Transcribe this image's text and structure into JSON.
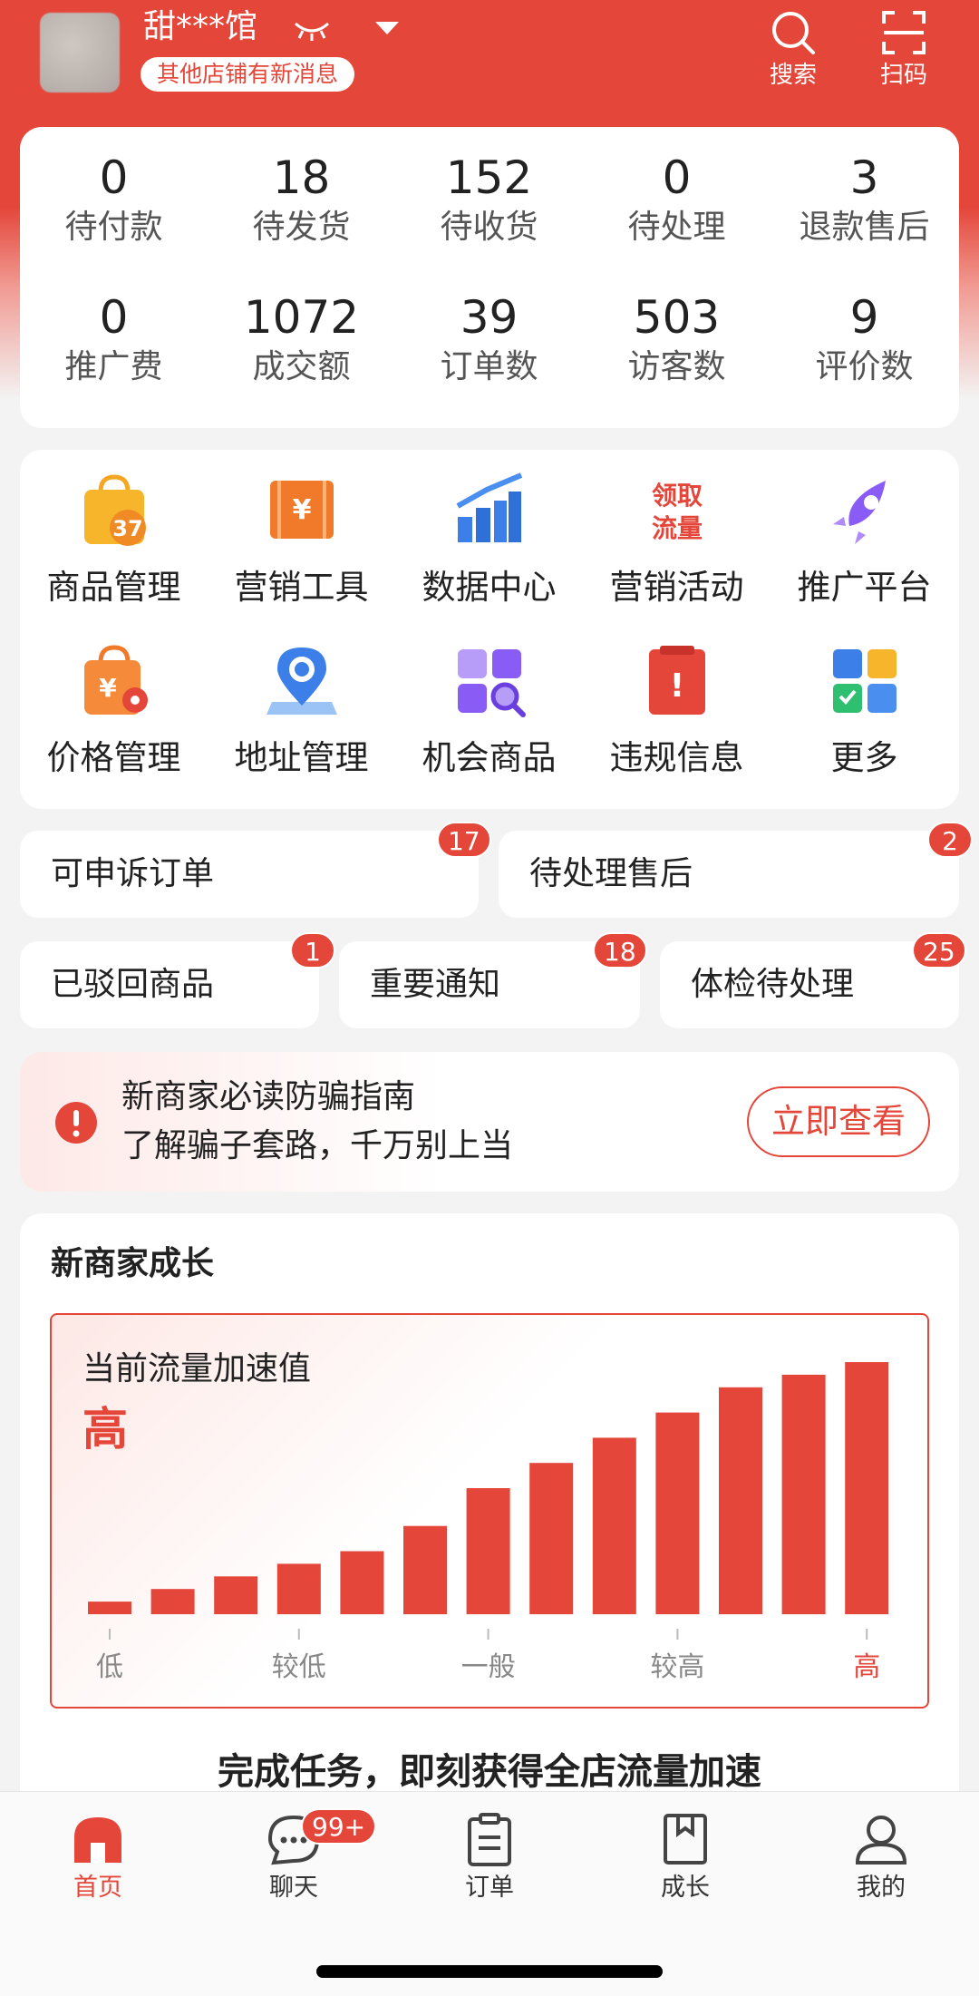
{
  "header": {
    "shop_name": "甜***馆",
    "shop_badge": "其他店铺有新消息",
    "search_label": "搜索",
    "scan_label": "扫码"
  },
  "stats": {
    "row1": [
      {
        "value": "0",
        "label": "待付款"
      },
      {
        "value": "18",
        "label": "待发货"
      },
      {
        "value": "152",
        "label": "待收货"
      },
      {
        "value": "0",
        "label": "待处理"
      },
      {
        "value": "3",
        "label": "退款售后"
      }
    ],
    "row2": [
      {
        "value": "0",
        "label": "推广费"
      },
      {
        "value": "1072",
        "label": "成交额"
      },
      {
        "value": "39",
        "label": "订单数"
      },
      {
        "value": "503",
        "label": "访客数"
      },
      {
        "value": "9",
        "label": "评价数"
      }
    ]
  },
  "tools": {
    "row1": [
      {
        "label": "商品管理",
        "icon": "shopping-bag-icon",
        "icon_text": "37"
      },
      {
        "label": "营销工具",
        "icon": "coupon-icon",
        "icon_text": "¥"
      },
      {
        "label": "数据中心",
        "icon": "bar-chart-icon"
      },
      {
        "label": "营销活动",
        "icon": "traffic-icon",
        "icon_text": [
          "领取",
          "流量"
        ]
      },
      {
        "label": "推广平台",
        "icon": "rocket-icon"
      }
    ],
    "row2": [
      {
        "label": "价格管理",
        "icon": "price-bag-icon",
        "icon_text": "¥"
      },
      {
        "label": "地址管理",
        "icon": "location-pin-icon"
      },
      {
        "label": "机会商品",
        "icon": "opportunity-grid-icon"
      },
      {
        "label": "违规信息",
        "icon": "violation-icon",
        "icon_text": "!"
      },
      {
        "label": "更多",
        "icon": "more-apps-icon"
      }
    ]
  },
  "pills": {
    "appealable_orders": {
      "label": "可申诉订单",
      "count": "17"
    },
    "pending_aftersale": {
      "label": "待处理售后",
      "count": "2"
    },
    "rejected_products": {
      "label": "已驳回商品",
      "count": "1"
    },
    "important_notice": {
      "label": "重要通知",
      "count": "18"
    },
    "health_check": {
      "label": "体检待处理",
      "count": "25"
    }
  },
  "alert": {
    "title": "新商家必读防骗指南",
    "subtitle": "了解骗子套路，千万别上当",
    "button": "立即查看"
  },
  "growth": {
    "title": "新商家成长",
    "chart_label": "当前流量加速值",
    "current_value": "高",
    "footer": "完成任务，即刻获得全店流量加速"
  },
  "chart_data": {
    "type": "bar",
    "title": "当前流量加速值",
    "values": [
      1,
      2,
      3,
      4,
      5,
      7,
      10,
      12,
      14,
      16,
      18,
      19,
      20
    ],
    "x_tick_labels": [
      "低",
      "较低",
      "一般",
      "较高",
      "高"
    ],
    "highlight_color": "#e4463a"
  },
  "tabbar": {
    "home": "首页",
    "chat": "聊天",
    "chat_badge": "99+",
    "orders": "订单",
    "growth": "成长",
    "mine": "我的"
  },
  "colors": {
    "brand": "#e4463a"
  }
}
